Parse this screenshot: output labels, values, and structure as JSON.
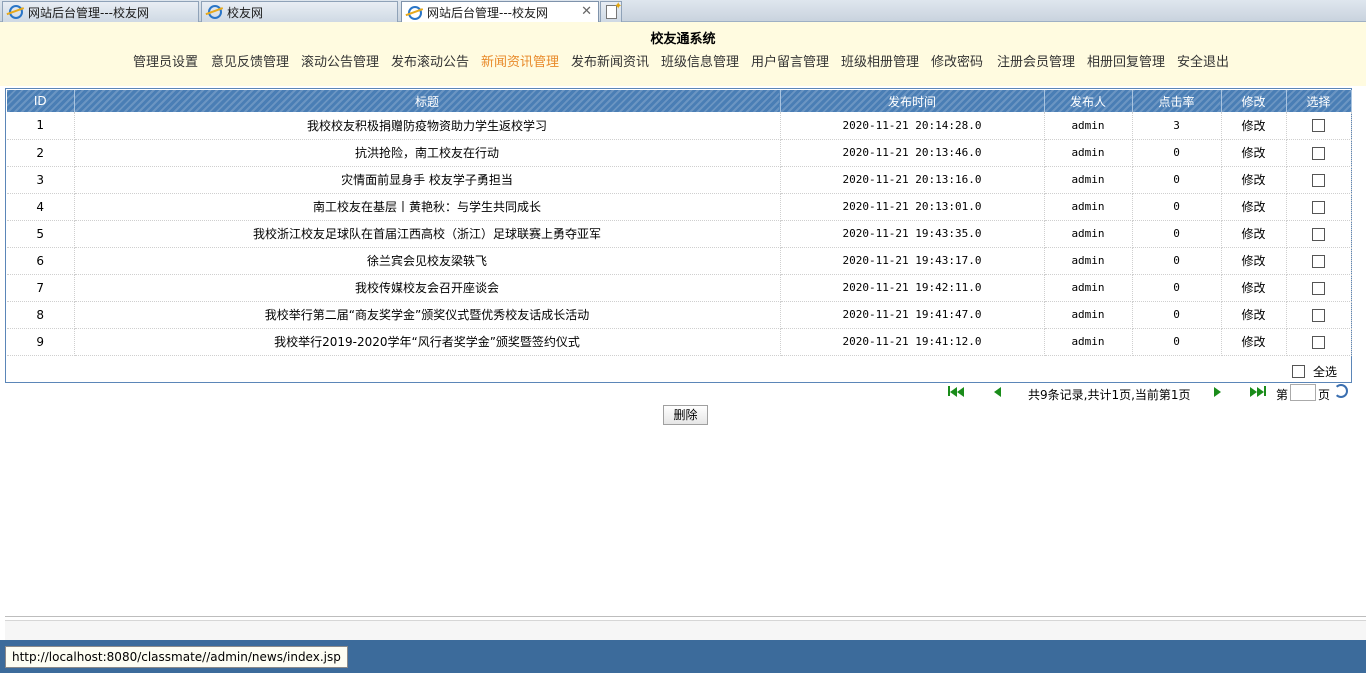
{
  "browser": {
    "tabs": [
      {
        "label": "网站后台管理---校友网",
        "active": false
      },
      {
        "label": "校友网",
        "active": false
      },
      {
        "label": "网站后台管理---校友网",
        "active": true
      }
    ],
    "status_url": "http://localhost:8080/classmate//admin/news/index.jsp"
  },
  "header": {
    "title": "校友通系统",
    "nav": [
      {
        "label": "管理员设置"
      },
      {
        "label": "意见反馈管理"
      },
      {
        "label": "滚动公告管理"
      },
      {
        "label": "发布滚动公告"
      },
      {
        "label": "新闻资讯管理",
        "active": true
      },
      {
        "label": "发布新闻资讯"
      },
      {
        "label": "班级信息管理"
      },
      {
        "label": "用户留言管理"
      },
      {
        "label": "班级相册管理"
      },
      {
        "label": "修改密码"
      },
      {
        "label": "注册会员管理"
      },
      {
        "label": "相册回复管理"
      },
      {
        "label": "安全退出"
      }
    ],
    "active_color": "#e88a2a"
  },
  "table": {
    "columns": [
      "ID",
      "标题",
      "发布时间",
      "发布人",
      "点击率",
      "修改",
      "选择"
    ],
    "rows": [
      {
        "id": "1",
        "title": "我校校友积极捐赠防疫物资助力学生返校学习",
        "time": "2020-11-21 20:14:28.0",
        "author": "admin",
        "clicks": "3",
        "edit": "修改"
      },
      {
        "id": "2",
        "title": "抗洪抢险，南工校友在行动",
        "time": "2020-11-21 20:13:46.0",
        "author": "admin",
        "clicks": "0",
        "edit": "修改"
      },
      {
        "id": "3",
        "title": "灾情面前显身手 校友学子勇担当",
        "time": "2020-11-21 20:13:16.0",
        "author": "admin",
        "clicks": "0",
        "edit": "修改"
      },
      {
        "id": "4",
        "title": "南工校友在基层丨黄艳秋：与学生共同成长",
        "time": "2020-11-21 20:13:01.0",
        "author": "admin",
        "clicks": "0",
        "edit": "修改"
      },
      {
        "id": "5",
        "title": "我校浙江校友足球队在首届江西高校（浙江）足球联赛上勇夺亚军",
        "time": "2020-11-21 19:43:35.0",
        "author": "admin",
        "clicks": "0",
        "edit": "修改"
      },
      {
        "id": "6",
        "title": "徐兰宾会见校友梁轶飞",
        "time": "2020-11-21 19:43:17.0",
        "author": "admin",
        "clicks": "0",
        "edit": "修改"
      },
      {
        "id": "7",
        "title": "我校传媒校友会召开座谈会",
        "time": "2020-11-21 19:42:11.0",
        "author": "admin",
        "clicks": "0",
        "edit": "修改"
      },
      {
        "id": "8",
        "title": "我校举行第二届“商友奖学金”颁奖仪式暨优秀校友话成长活动",
        "time": "2020-11-21 19:41:47.0",
        "author": "admin",
        "clicks": "0",
        "edit": "修改"
      },
      {
        "id": "9",
        "title": "我校举行2019-2020学年“风行者奖学金”颁奖暨签约仪式",
        "time": "2020-11-21 19:41:12.0",
        "author": "admin",
        "clicks": "0",
        "edit": "修改"
      }
    ],
    "select_all_label": "全选"
  },
  "pager": {
    "summary": "共9条记录,共计1页,当前第1页",
    "page_prefix": "第",
    "page_suffix": "页",
    "page_value": ""
  },
  "actions": {
    "delete_label": "删除"
  }
}
